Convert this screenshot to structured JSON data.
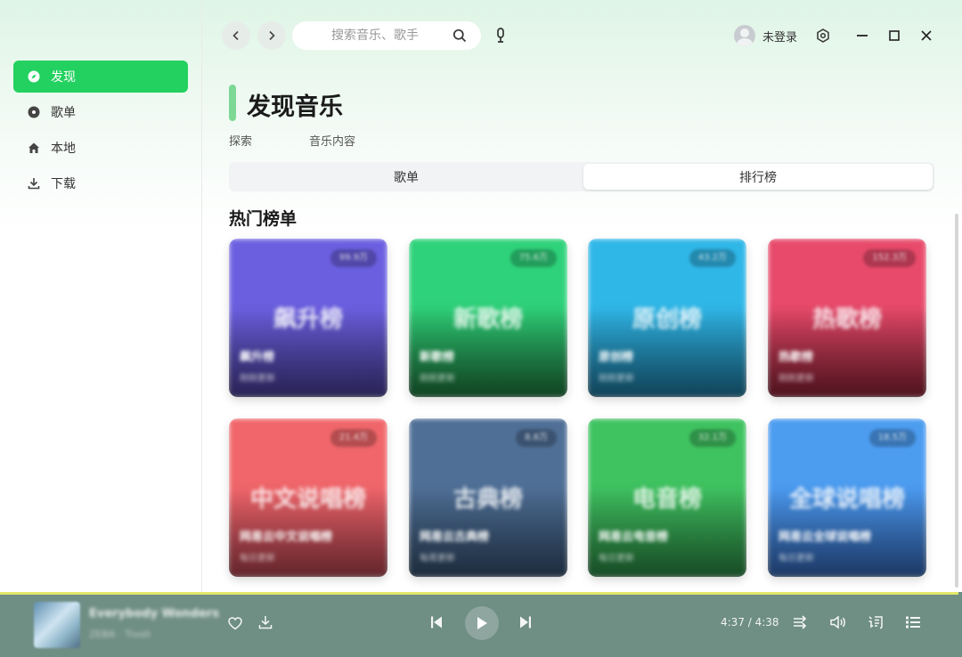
{
  "sidebar": {
    "items": [
      {
        "label": "发现",
        "icon": "compass-icon"
      },
      {
        "label": "歌单",
        "icon": "disc-icon"
      },
      {
        "label": "本地",
        "icon": "home-icon"
      },
      {
        "label": "下载",
        "icon": "download-icon"
      }
    ]
  },
  "header": {
    "search_placeholder": "搜索音乐、歌手",
    "user_label": "未登录"
  },
  "page": {
    "title": "发现音乐",
    "sub_left": "探索",
    "sub_right": "音乐内容",
    "tabs": [
      "歌单",
      "排行榜"
    ],
    "selected_tab": "排行榜",
    "section_title": "热门榜单"
  },
  "cards": [
    {
      "big": "飙升榜",
      "name": "飙升榜",
      "meta": "刚刚更新",
      "badge": "99.9万",
      "colors": [
        "#6b5fe0",
        "#4a3f9a"
      ]
    },
    {
      "big": "新歌榜",
      "name": "新歌榜",
      "meta": "刚刚更新",
      "badge": "75.6万",
      "colors": [
        "#2ed27a",
        "#1f7a3f"
      ]
    },
    {
      "big": "原创榜",
      "name": "原创榜",
      "meta": "刚刚更新",
      "badge": "43.2万",
      "colors": [
        "#2fb7e8",
        "#1e7aa0"
      ]
    },
    {
      "big": "热歌榜",
      "name": "热歌榜",
      "meta": "刚刚更新",
      "badge": "152.3万",
      "colors": [
        "#e84a6b",
        "#8f2236"
      ]
    },
    {
      "big": "中文说唱榜",
      "name": "网易云中文说唱榜",
      "meta": "每日更新",
      "badge": "21.4万",
      "colors": [
        "#f0666a",
        "#b54350"
      ]
    },
    {
      "big": "古典榜",
      "name": "网易云古典榜",
      "meta": "每周更新",
      "badge": "8.8万",
      "colors": [
        "#4f6f96",
        "#35506f"
      ]
    },
    {
      "big": "电音榜",
      "name": "网易云电音榜",
      "meta": "每日更新",
      "badge": "32.1万",
      "colors": [
        "#3fc260",
        "#2b8a45"
      ]
    },
    {
      "big": "全球说唱榜",
      "name": "网易云全球说唱榜",
      "meta": "每日更新",
      "badge": "18.5万",
      "colors": [
        "#4c9cf0",
        "#3367b8"
      ]
    }
  ],
  "player": {
    "song": "Everybody Wonders",
    "artist": "ZEBA · Tivoli",
    "time": "4:37 / 4:38",
    "progress": 0.996
  }
}
